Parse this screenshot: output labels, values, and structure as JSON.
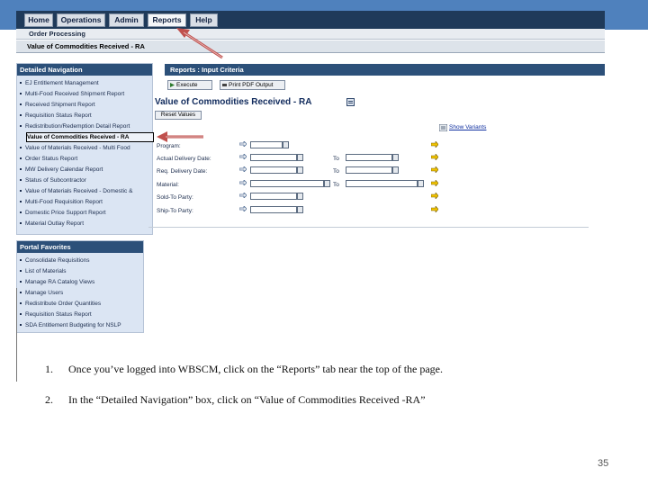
{
  "menu": {
    "tabs": [
      {
        "label": "Home"
      },
      {
        "label": "Operations"
      },
      {
        "label": "Admin"
      },
      {
        "label": "Reports"
      },
      {
        "label": "Help"
      }
    ],
    "subnav": "Order Processing",
    "page_title_bar": "Value of Commodities Received - RA"
  },
  "detailed_navigation": {
    "header": "Detailed Navigation",
    "items": [
      "EJ Entitlement Management",
      "Multi-Food Received Shipment Report",
      "Received Shipment Report",
      "Requisition Status Report",
      "Redistribution/Redemption Detail Report",
      "Value of Commodities Received - RA",
      "Value of Materials Received - Multi Food",
      "Order Status Report",
      "MW Delivery Calendar Report",
      "Status of Subcontractor",
      "Value of Materials Received - Domestic &",
      "Multi-Food Requisition Report",
      "Domestic Price Support Report",
      "Material Outlay Report"
    ]
  },
  "portal_favorites": {
    "header": "Portal Favorites",
    "items": [
      "Consolidate Requisitions",
      "List of Materials",
      "Manage RA Catalog Views",
      "Manage Users",
      "Redistribute Order Quantities",
      "Requisition Status Report",
      "SDA Entitlement Budgeting for NSLP"
    ]
  },
  "report": {
    "header": "Reports : Input Criteria",
    "execute_label": "Execute",
    "print_label": "Print PDF Output",
    "title": "Value of Commodities Received - RA",
    "reset_label": "Reset Values",
    "show_variants": "Show Variants",
    "criteria": [
      {
        "label": "Program:"
      },
      {
        "label": "Actual Delivery Date:",
        "to": "To"
      },
      {
        "label": "Req. Delivery Date:",
        "to": "To"
      },
      {
        "label": "Material:",
        "to": "To"
      },
      {
        "label": "Sold-To Party:"
      },
      {
        "label": "Ship-To Party:"
      }
    ]
  },
  "instructions": [
    {
      "num": "1.",
      "text": "Once you’ve logged into WBSCM, click on the “Reports” tab near the top of the page."
    },
    {
      "num": "2.",
      "text": "In the “Detailed Navigation” box, click on “Value of Commodities Received -RA”"
    }
  ],
  "page_number": "35",
  "colors": {
    "band": "#4f81bd",
    "sap_header": "#2c5079",
    "panel_body": "#dbe5f3",
    "arrow": "#c0504d"
  },
  "icons": {
    "criteria_arrow": "right-arrow-icon",
    "value_help": "value-help-icon",
    "multiple_selection": "multiple-selection-icon"
  }
}
